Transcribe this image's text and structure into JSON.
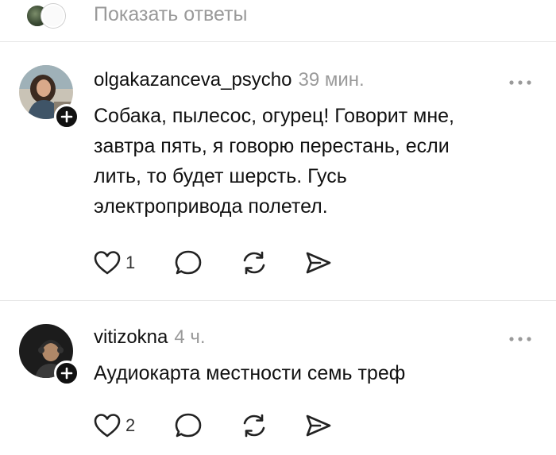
{
  "show_replies": {
    "label": "Показать ответы"
  },
  "comments": [
    {
      "username": "olgakazanceva_psycho",
      "time": "39 мин.",
      "text_lines": [
        "Собака, пылесос, огурец! Говорит мне,",
        "завтра пять, я говорю перестань, если",
        "лить, то будет шерсть. Гусь",
        "электропривода полетел."
      ],
      "likes": "1"
    },
    {
      "username": "vitizokna",
      "time": "4 ч.",
      "text_lines": [
        "Аудиокарта местности семь треф"
      ],
      "likes": "2"
    }
  ],
  "icons": {
    "like": "heart-icon",
    "reply": "speech-bubble-icon",
    "repost": "repost-icon",
    "share": "send-icon",
    "more": "ellipsis-icon",
    "follow": "plus-icon"
  }
}
